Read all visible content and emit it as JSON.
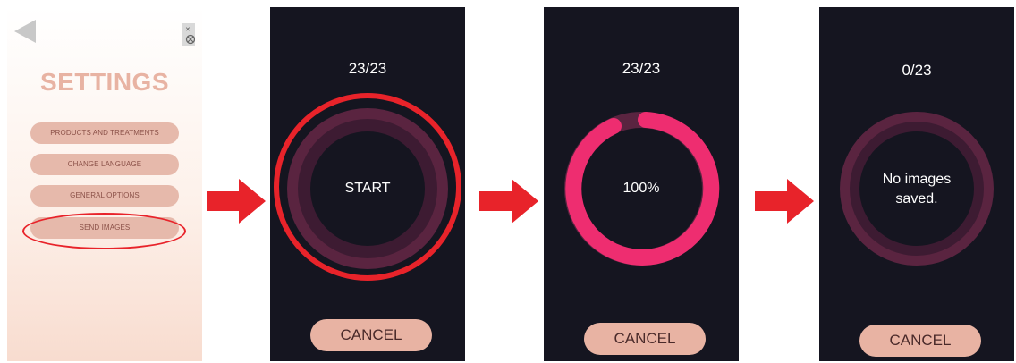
{
  "settings": {
    "title": "SETTINGS",
    "menu": [
      {
        "label": "PRODUCTS AND TREATMENTS"
      },
      {
        "label": "CHANGE LANGUAGE"
      },
      {
        "label": "GENERAL OPTIONS"
      },
      {
        "label": "SEND IMAGES"
      }
    ]
  },
  "screens": [
    {
      "count": "23/23",
      "center_text": "START",
      "cancel_label": "CANCEL"
    },
    {
      "count": "23/23",
      "center_text": "100%",
      "progress": 1.0,
      "cancel_label": "CANCEL"
    },
    {
      "count": "0/23",
      "center_line1": "No images",
      "center_line2": "saved.",
      "cancel_label": "CANCEL"
    }
  ],
  "colors": {
    "screen_bg": "#151520",
    "ring_track": "#5a2440",
    "ring_inner": "#3a1a30",
    "progress_pink": "#ee2d70",
    "button_peach": "#e8b3a3",
    "highlight_red": "#e8232a"
  }
}
